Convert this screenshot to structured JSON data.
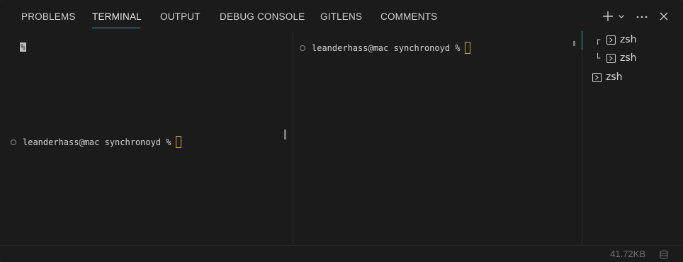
{
  "tabs": [
    {
      "label": "PROBLEMS"
    },
    {
      "label": "TERMINAL"
    },
    {
      "label": "OUTPUT"
    },
    {
      "label": "DEBUG CONSOLE"
    },
    {
      "label": "GITLENS"
    },
    {
      "label": "COMMENTS"
    }
  ],
  "active_tab": "TERMINAL",
  "actions": {
    "new_terminal_icon": "plus-icon",
    "dropdown_icon": "chevron-down-icon",
    "more_icon": "ellipsis-icon",
    "close_icon": "close-icon"
  },
  "left_terminal": {
    "leftover": "%",
    "prompt": "leanderhass@mac synchronoyd %"
  },
  "right_terminal": {
    "prompt": "leanderhass@mac synchronoyd %"
  },
  "terminal_list": [
    {
      "label": "zsh",
      "tree": "┌",
      "active": true
    },
    {
      "label": "zsh",
      "tree": "└",
      "active": false
    },
    {
      "label": "zsh",
      "tree": "",
      "active": false
    }
  ],
  "status": {
    "size": "41.72KB",
    "icon": "database-icon"
  },
  "colors": {
    "accent": "#3fa7a0",
    "cursor": "#d6a445",
    "background": "#1b1b1b"
  }
}
